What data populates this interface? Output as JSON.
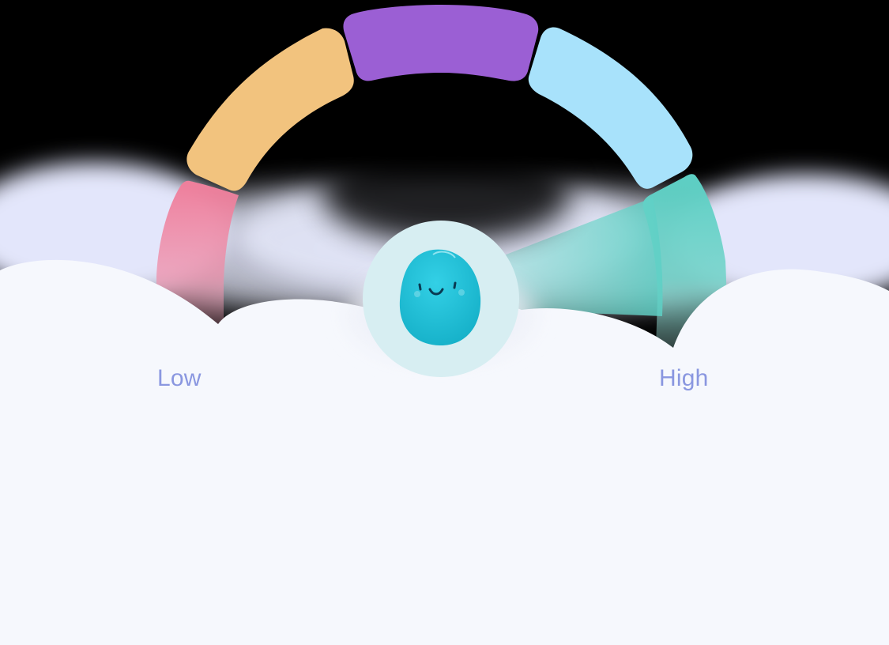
{
  "gauge": {
    "low_label": "Low",
    "high_label": "High",
    "segments": [
      {
        "name": "red",
        "color": "#ef7f9c"
      },
      {
        "name": "orange",
        "color": "#f2c37e"
      },
      {
        "name": "purple",
        "color": "#9b5fd4"
      },
      {
        "name": "light-blue",
        "color": "#a8e2fb"
      },
      {
        "name": "teal",
        "color": "#5dd0c5"
      }
    ],
    "selected_segment": "teal",
    "indicator": {
      "icon": "smiling-blob-icon",
      "color": "#29c1d8"
    }
  },
  "colors": {
    "background": "#000000",
    "cloud": "#f6f8fd",
    "label": "#8a97e0"
  }
}
